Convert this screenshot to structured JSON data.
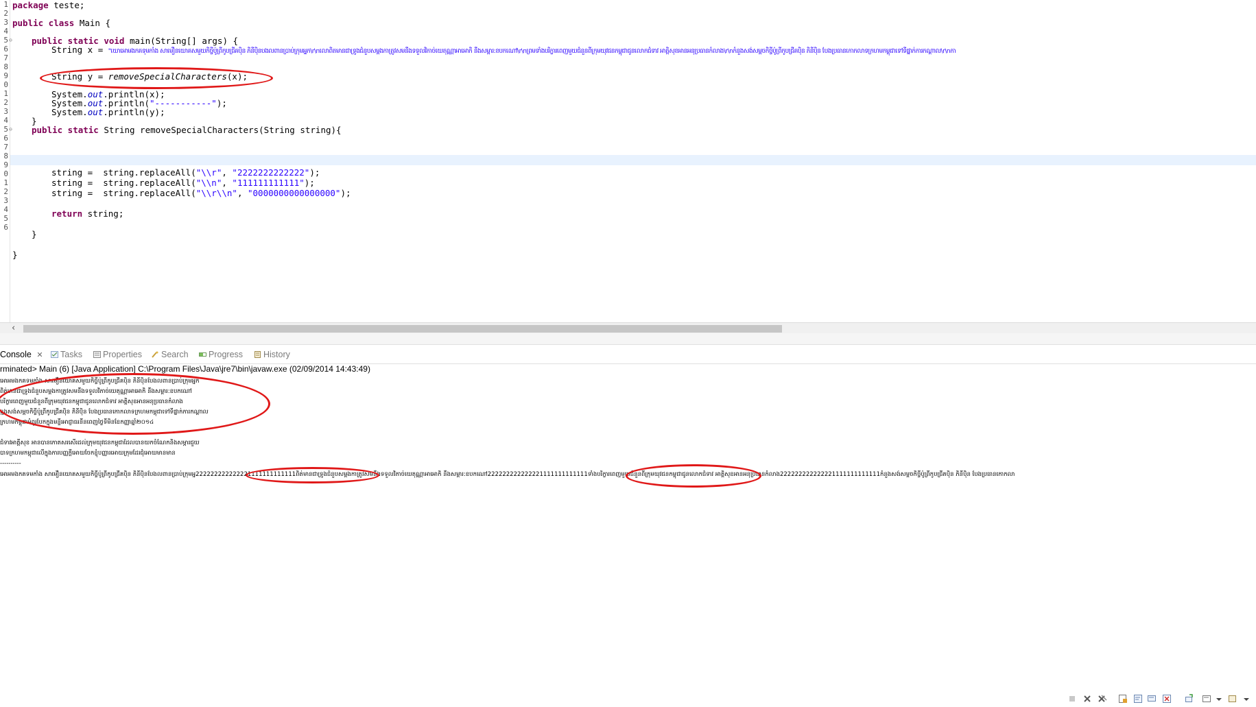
{
  "editor": {
    "line_numbers": [
      "1",
      "2",
      "3",
      "4",
      "5",
      "6",
      "7",
      "8",
      "9",
      "0",
      "1",
      "2",
      "3",
      "4",
      "5",
      "6",
      "7",
      "8",
      "9",
      "0",
      "1",
      "2",
      "3",
      "4",
      "5",
      "6"
    ],
    "code": {
      "l1_kw": "package",
      "l1_rest": " teste;",
      "l3_kw": "public class",
      "l3_rest": " Main {",
      "l5_kw": "public static void",
      "l5_rest": " main(String[] args) {",
      "l6_pre": "String x = ",
      "l6_str": "\"យោអោមងកគទុមកាំង សាមឿនយោគសមួយកិច្ចីប៉ូព្រីកូបជ្រីគបុិន ភិនីប៉ិនបងលពានប្រាប់ក្រុមអ្នក\\r\\nលោពិតមានជាទ្រូងជំនួបសម្ពងកាត្រូវសមនឹងទទួលវិភាច់យេតុណ្ណាអាអោកិ នឹងសម្ពារ:ខបកណៅ\\r\\nព្រមទាំងបរិក្ខារពេញមួយជំនួនពីក្រុមយុវជនកម្ពុជាជូនលោកជំទាវ អាត្តិសុខអានអនុប្រធានកំលាង\\r\\nកំនួងសង់សម្ពចកិច្ចីប៉ូព្រីកូបជ្រីគបុិន ភិនីប៉ិន បែងប្រធានកោកលាទក្រហមកម្ពុជាទៅទីផ្នាក់ការកណ្ដាល\\r\\nកា",
      "l8_text": "String y = ",
      "l8_call": "removeSpecialCharacters",
      "l8_end": "(x);",
      "l10_a": "System.",
      "l10_out": "out",
      "l10_b": ".println(x);",
      "l11_a": "System.",
      "l11_out": "out",
      "l11_b": ".println(",
      "l11_str": "\"-----------\"",
      "l11_c": ");",
      "l12_a": "System.",
      "l12_out": "out",
      "l12_b": ".println(y);",
      "l13": "}",
      "l15_kw": "public static",
      "l15_rest": " String removeSpecialCharacters(String string){",
      "l17_a": "string =  string.replaceAll(",
      "l17_s1": "\"\\\\r\"",
      "l17_c": ", ",
      "l17_s2": "\"2222222222222\"",
      "l17_e": ");",
      "l18_a": "string =  string.replaceAll(",
      "l18_s1": "\"\\\\n\"",
      "l18_c": ", ",
      "l18_s2": "\"111111111111\"",
      "l18_e": ");",
      "l19_a": "string =  string.replaceAll(",
      "l19_s1": "\"\\\\r\\\\n\"",
      "l19_c": ", ",
      "l19_s2": "\"0000000000000000\"",
      "l19_e": ");",
      "l21_kw": "return",
      "l21_rest": " string;",
      "l23": "}",
      "l25": "}"
    }
  },
  "console": {
    "tabs": [
      "Console",
      "Tasks",
      "Properties",
      "Search",
      "Progress",
      "History"
    ],
    "status": "rminated> Main (6) [Java Application] C:\\Program Files\\Java\\jre7\\bin\\javaw.exe (02/09/2014 14:43:49)",
    "output_lines": [
      "អោអមងកគទមកាំង សាមឿនយោគសមួយកិច្ចីប៉ូព្រីកូបជ្រីគបុិន ភិនីប៉ិនបែងលពានប្រាប់ក្រុមអ្នក",
      "ពិត់មានជាទ្រូងជំនួបសម្ពងកាត្រូវសមនឹងទទួលវិភាច់យេតុណ្ណាអាអោកិ នឹងសម្ពារ:ខបកណៅ",
      "បរិក្ខារពេញមួយជំនួនពីក្រុមយុវជនកម្ពុជាជូនលោកជំទាវ អាត្តិសុខអានអនុប្រធានកំលាង",
      "ខ្មងសង់សម្ពចកិច្ចីប៉ូព្រីកូបជ្រីគបុិន ភិនីប៉ិន បែងប្រធានកោកលាទក្រហមកម្ពុជាទៅទីផ្នាក់ការកណ្ដាល",
      "ក្រហមកម្ពុជាអំពូរបែកក្នុងមន្ទីរអាជ្ញាធរនីនពេញថ្ងៃទីមិនខែកញ្ញាឆ្នាំ២០១៤",
      "",
      "ជំទាវអាត្តីសុខ អានបានកោតសរសើរដល់ក្រុមយុវជនកម្ពុជាដែលបានយកចំណែកនិងសម្ភារជួយ",
      "បាទក្រហមកម្ពុជាលើក្នុងការបញ្ញក្តីអោយចែកខ្ញុំបញ្ញារអោយក្រុមដែរជុំអោយមានមាន",
      "----------",
      "អោអមងកគទមកាំង សាមឿនយោគសមួយកិច្ចីប៉ូព្រីកូបជ្រីគបុិន ភិនីប៉ិនបែងលពានប្រាប់ក្រុមអ្ន222222222222221111111111111ពិត់មានជាទ្រូងជំនួបសម្ពងកាត្រូវសមនឹងទទួលវិភាច់យេតុណ្ណាអាអោកិ នឹងសម្ពារ:ខបកណៅ222222222222221111111111111ទាំងបរិក្ខារពេញមួយជំនួនពីក្រុមយុវជនកម្ពុជាជូនលោកជំទាវ អាត្តិសុខអានអនុប្រធានកំលាង222222222222221111111111111កំនួងសង់សម្ពចកិច្ចីប៉ូព្រីកូបជ្រីគបុិន ភិនីប៉ិន បែងប្រធានកោកលា"
    ]
  },
  "colors": {
    "keyword": "#7f0055",
    "string": "#2a00ff",
    "field": "#0000c0",
    "annotation_oval": "#e01818"
  },
  "icons": [
    "console-icon",
    "tasks-icon",
    "properties-icon",
    "search-icon",
    "progress-icon",
    "history-icon",
    "terminate-icon",
    "remove-launch-icon",
    "remove-all-icon",
    "scroll-lock-icon",
    "word-wrap-icon",
    "pin-console-icon",
    "display-console-icon",
    "new-console-icon"
  ]
}
